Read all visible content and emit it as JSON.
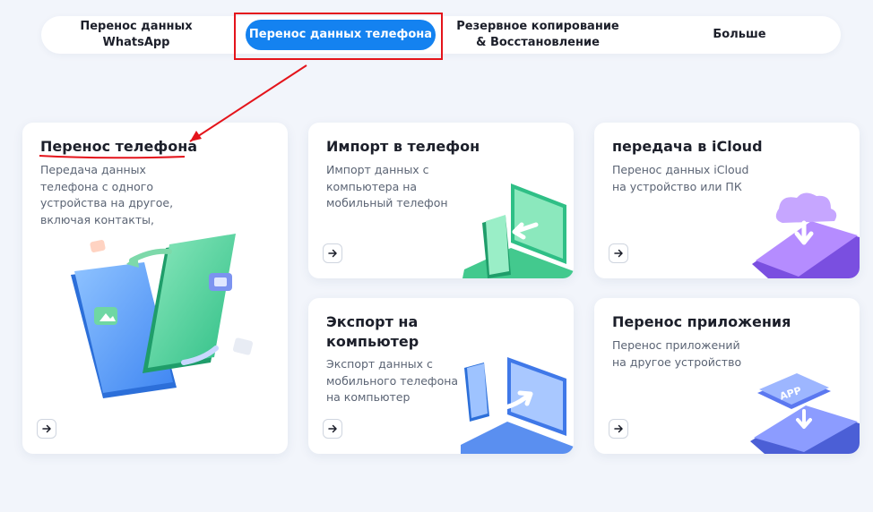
{
  "tabs": {
    "whatsapp": "Перенос данных WhatsApp",
    "phone": "Перенос данных телефона",
    "backup_line1": "Резервное копирование",
    "backup_line2": "& Восстановление",
    "more": "Больше"
  },
  "cards": {
    "phone_transfer": {
      "title": "Перенос телефона",
      "desc_lines": [
        "Передача данных",
        "телефона с одного",
        "устройства на другое,",
        "включая контакты,"
      ]
    },
    "import": {
      "title": "Импорт в телефон",
      "desc_lines": [
        "Импорт данных с",
        "компьютера на",
        "мобильный телефон"
      ]
    },
    "icloud": {
      "title": "передача в iCloud",
      "desc_lines": [
        "Перенос данных iCloud",
        "на устройство или ПК"
      ]
    },
    "export": {
      "title_line1": "Экспорт на",
      "title_line2": "компьютер",
      "desc_lines": [
        "Экспорт данных с",
        "мобильного телефона",
        "на компьютер"
      ]
    },
    "app_transfer": {
      "title": "Перенос приложения",
      "desc_lines": [
        "Перенос приложений",
        "на другое устройство"
      ],
      "app_badge": "APP"
    }
  },
  "icons": {
    "go": "arrow-right-icon"
  },
  "colors": {
    "accent": "#1482f0",
    "annotation": "#e4141b"
  }
}
